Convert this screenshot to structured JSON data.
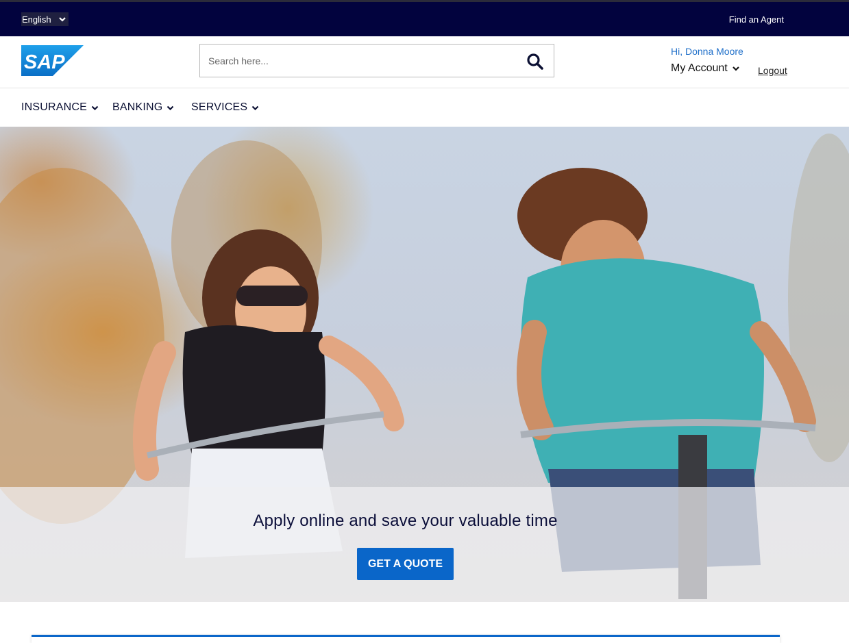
{
  "top_bar": {
    "language": "English",
    "find_agent": "Find an Agent"
  },
  "header": {
    "logo_text": "SAP",
    "search_placeholder": "Search here...",
    "greeting": "Hi, Donna Moore",
    "my_account": "My Account",
    "logout": "Logout"
  },
  "nav": {
    "items": [
      {
        "label": "INSURANCE"
      },
      {
        "label": "BANKING"
      },
      {
        "label": "SERVICES"
      }
    ]
  },
  "hero": {
    "title": "Apply online and save your valuable time",
    "cta": "GET A QUOTE"
  },
  "icons": {
    "language_chevron": "chevron-down-icon",
    "search": "search-icon",
    "account_chevron": "chevron-down-icon",
    "nav_chevron": "chevron-down-icon"
  },
  "colors": {
    "top_bar_bg": "#02033e",
    "accent": "#0a66c9",
    "greeting": "#1f6fc9",
    "nav_text": "#0b1033"
  }
}
